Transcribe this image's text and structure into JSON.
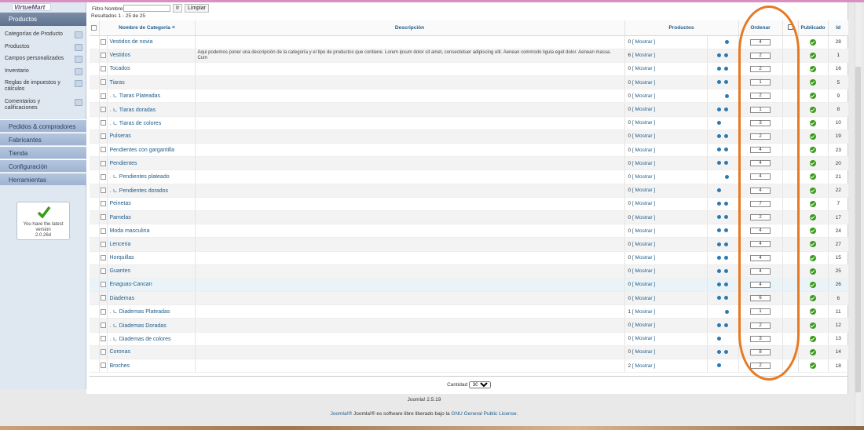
{
  "sidebar": {
    "logo_text": "VirtueMart",
    "section_title": "Productos",
    "items": [
      {
        "label": "Categorías de Producto"
      },
      {
        "label": "Productos"
      },
      {
        "label": "Campos personalizados"
      },
      {
        "label": "Inventario"
      },
      {
        "label": "Reglas de impuestos y cálculos"
      },
      {
        "label": "Comentarios y calificaciones"
      }
    ],
    "categories": [
      {
        "label": "Pedidos & compradores"
      },
      {
        "label": "Fabricantes"
      },
      {
        "label": "Tienda"
      },
      {
        "label": "Configuración"
      },
      {
        "label": "Herramientas"
      }
    ],
    "version_box": {
      "line1": "You have the latest",
      "line2": "version",
      "line3": "2.0.26d"
    }
  },
  "filter": {
    "label": "Filtro Nombre:",
    "value": "",
    "go_label": "Ir",
    "clear_label": "Limpiar"
  },
  "results_text": "Resultados 1 - 25 de 25",
  "table": {
    "headers": {
      "name": "Nombre de Categoría",
      "description": "Descripción",
      "products": "Productos",
      "order": "Ordenar",
      "published": "Publicado",
      "id": "Id"
    },
    "show_label": "[ Mostrar ]",
    "rows": [
      {
        "name": "Vestidos de novia",
        "desc": "",
        "count": "0",
        "arrows": "down",
        "order": "4",
        "id": "28"
      },
      {
        "name": "Vestidos",
        "desc": "Aqui podemos poner una descripción de la categoría y el tipo de productos que contiene. Lorem ipsum dolor sit amet, consectetuer adipiscing elit. Aenean commodo ligula eget dolor. Aenean massa. Cum",
        "count": "6",
        "arrows": "both",
        "order": "2",
        "id": "1"
      },
      {
        "name": "Tocados",
        "desc": "",
        "count": "0",
        "arrows": "both",
        "order": "2",
        "id": "16"
      },
      {
        "name": "Tiaras",
        "desc": "",
        "count": "0",
        "arrows": "both",
        "order": "1",
        "id": "5"
      },
      {
        "name": ". ㄴ Tiaras Plateadas",
        "desc": "",
        "count": "0",
        "arrows": "down",
        "order": "2",
        "id": "9"
      },
      {
        "name": ". ㄴ Tiaras doradas",
        "desc": "",
        "count": "0",
        "arrows": "both",
        "order": "1",
        "id": "8"
      },
      {
        "name": ". ㄴ Tiaras de colores",
        "desc": "",
        "count": "0",
        "arrows": "up",
        "order": "3",
        "id": "10"
      },
      {
        "name": "Pulseras",
        "desc": "",
        "count": "0",
        "arrows": "both",
        "order": "2",
        "id": "19"
      },
      {
        "name": "Pendientes con gargantilla",
        "desc": "",
        "count": "0",
        "arrows": "both",
        "order": "4",
        "id": "23"
      },
      {
        "name": "Pendientes",
        "desc": "",
        "count": "0",
        "arrows": "both",
        "order": "4",
        "id": "20"
      },
      {
        "name": ". ㄴ Pendientes plateado",
        "desc": "",
        "count": "0",
        "arrows": "down",
        "order": "4",
        "id": "21"
      },
      {
        "name": ". ㄴ Pendientes dorados",
        "desc": "",
        "count": "0",
        "arrows": "up",
        "order": "4",
        "id": "22"
      },
      {
        "name": "Peinetas",
        "desc": "",
        "count": "0",
        "arrows": "both",
        "order": "7",
        "id": "7"
      },
      {
        "name": "Pamelas",
        "desc": "",
        "count": "0",
        "arrows": "both",
        "order": "2",
        "id": "17"
      },
      {
        "name": "Moda masculina",
        "desc": "",
        "count": "0",
        "arrows": "both",
        "order": "4",
        "id": "24"
      },
      {
        "name": "Lenceria",
        "desc": "",
        "count": "0",
        "arrows": "both",
        "order": "4",
        "id": "27"
      },
      {
        "name": "Horquillas",
        "desc": "",
        "count": "0",
        "arrows": "both",
        "order": "4",
        "id": "15"
      },
      {
        "name": "Guantes",
        "desc": "",
        "count": "0",
        "arrows": "both",
        "order": "4",
        "id": "25"
      },
      {
        "name": "Enaguas-Cancan",
        "desc": "",
        "count": "0",
        "arrows": "both",
        "order": "4",
        "id": "26"
      },
      {
        "name": "Diademas",
        "desc": "",
        "count": "0",
        "arrows": "both",
        "order": "6",
        "id": "6"
      },
      {
        "name": ". ㄴ Diademas Plateadas",
        "desc": "",
        "count": "1",
        "arrows": "down",
        "order": "1",
        "id": "11"
      },
      {
        "name": ". ㄴ Diademas Doradas",
        "desc": "",
        "count": "0",
        "arrows": "both",
        "order": "2",
        "id": "12"
      },
      {
        "name": ". ㄴ Diademas de colores",
        "desc": "",
        "count": "0",
        "arrows": "up",
        "order": "3",
        "id": "13"
      },
      {
        "name": "Coronas",
        "desc": "",
        "count": "0",
        "arrows": "both",
        "order": "8",
        "id": "14"
      },
      {
        "name": "Broches",
        "desc": "",
        "count": "2",
        "arrows": "up",
        "order": "2",
        "id": "18"
      }
    ]
  },
  "pagination": {
    "label": "Cantidad",
    "value": "30"
  },
  "footer": {
    "version": "Joomla! 2.5.19",
    "license_prefix": "Joomla!® es software libre liberado bajo la",
    "license_link": "GNU General Public License."
  },
  "colors": {
    "accent": "#1f5c8a",
    "published": "#3a9a1a",
    "annotation": "#e67a23"
  }
}
